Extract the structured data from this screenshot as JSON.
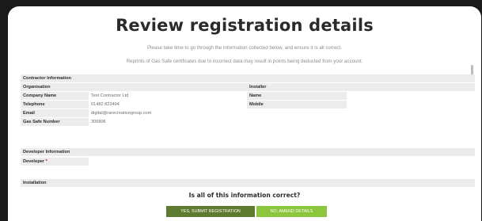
{
  "header": {
    "title": "Review registration details",
    "subtitle_1": "Please take time to go through the information collected below, and ensure it is all correct.",
    "subtitle_2": "Reprints of Gas Safe certificates due to incorrect data may result in points being deducted from your account."
  },
  "contractor": {
    "section_title": "Contractor Information",
    "organisation_label": "Organisation",
    "installer_label": "Installer",
    "company_name_label": "Company Name",
    "company_name_value": "Test Contractor Ltd",
    "telephone_label": "Telephone",
    "telephone_value": "01482 823494",
    "email_label": "Email",
    "email_value": "digital@rarecreativegroup.com",
    "gas_safe_label": "Gas Safe Number",
    "gas_safe_value": "306806",
    "name_label": "Name",
    "name_value": "",
    "mobile_label": "Mobile",
    "mobile_value": ""
  },
  "developer": {
    "section_title": "Developer Information",
    "developer_label": "Developer",
    "required_marker": "*",
    "developer_value": ""
  },
  "installation": {
    "section_title": "Installation"
  },
  "footer": {
    "question": "Is all of this information correct?",
    "yes_label": "YES, SUBMIT REGISTRATION",
    "no_label": "NO, AMEND DETAILS"
  },
  "colors": {
    "yes_button": "#5e7a2e",
    "no_button": "#8cc63f",
    "required": "#d0021b"
  }
}
